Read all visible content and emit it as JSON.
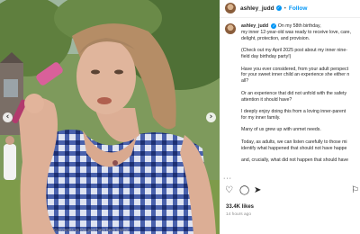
{
  "post": {
    "username": "ashley_judd",
    "follow_label": "Follow",
    "likes": "33.4K likes",
    "time_ago": "14 hours ago",
    "comment_hint": "Comments on this post have been limited"
  },
  "caption": {
    "lines": [
      "On my 58th birthday,",
      "my inner 12-year-old was ready to receive love, care,",
      "delight, protection, and provision.",
      "",
      "(Check out my April 2025 post about my inner nine-",
      "field day birthday party!)",
      "",
      "Have you ever considered, from your adult perspect",
      "for your sweet inner child an experience she either n",
      "all?",
      "",
      "Or an experience that did not unfold with the safety",
      "attention it should have?",
      "",
      "I deeply enjoy doing this from a loving inner-parent",
      "for my inner family.",
      "",
      "Many of us grew up with unmet needs.",
      "",
      "Today, as adults, we can listen carefully to those mi",
      "identify what happened that should not have happe",
      "",
      "and, crucially, what did not happen that should have"
    ]
  },
  "colors": {
    "link": "#0095f6",
    "shirt": "#2f4aa0",
    "grass": "#6f8a4e"
  },
  "icons": [
    "chevron-left-icon",
    "chevron-right-icon",
    "verified-badge-icon",
    "heart-icon",
    "comment-icon",
    "share-icon",
    "bookmark-icon",
    "more-icon"
  ]
}
